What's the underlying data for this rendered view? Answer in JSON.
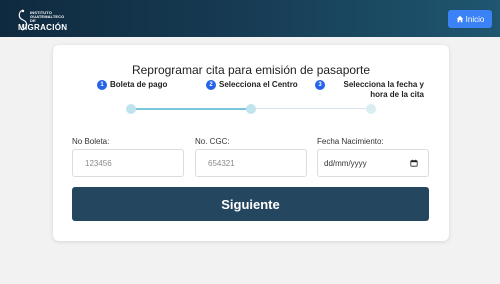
{
  "header": {
    "logo_small_text": "Instituto Guatemalteco de",
    "logo_main_text": "MIGRACIÓN",
    "home_label": "Inicio"
  },
  "form": {
    "title": "Reprogramar cita para emisión de pasaporte",
    "steps": [
      {
        "number": "1",
        "label": "Boleta de pago"
      },
      {
        "number": "2",
        "label": "Selecciona el Centro"
      },
      {
        "number": "3",
        "label": "Selecciona la fecha y hora de la cita"
      }
    ],
    "progress_fraction": 0.5,
    "fields": {
      "boleta": {
        "label": "No Boleta:",
        "placeholder": "123456"
      },
      "cgc": {
        "label": "No. CGC:",
        "placeholder": "654321"
      },
      "fecha": {
        "label": "Fecha Nacimiento:",
        "placeholder": "dd/mm/yyyy"
      }
    },
    "submit_label": "Siguiente"
  },
  "colors": {
    "header_dark": "#0f2a3f",
    "header_light": "#1f5670",
    "home_button": "#3b82f6",
    "step_badge": "#2563eb",
    "progress": "#7cc6dd",
    "submit_button": "#24475f"
  }
}
